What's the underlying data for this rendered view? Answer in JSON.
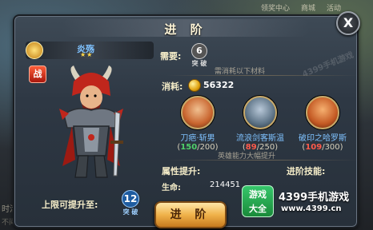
{
  "background": {
    "top_items": [
      "领奖中心",
      "商城",
      "活动"
    ],
    "left_text": "时活动",
    "left_text2": "不间断测试开始"
  },
  "dialog": {
    "title": "进  阶",
    "close_label": "X"
  },
  "hero": {
    "name": "炎殇",
    "stars": "★★",
    "class_badge": "战",
    "limit_label": "上限可提升至:",
    "limit_value": "12",
    "limit_unit": "突 破"
  },
  "requirement": {
    "label": "需要:",
    "value": "6",
    "unit": "突 破"
  },
  "materials_header": "需消耗以下材料",
  "cost": {
    "label": "消耗:",
    "value": "56322"
  },
  "materials": [
    {
      "name": "刀疤·斩男",
      "have": "150",
      "need": "/200",
      "portrait_color": "#c8642e"
    },
    {
      "name": "流浪剑客斯温",
      "have": "89",
      "need": "/250",
      "portrait_color": "#5d7386"
    },
    {
      "name": "破印之哈罗斯",
      "have": "109",
      "need": "/300",
      "portrait_color": "#c45a24"
    }
  ],
  "ability_header": "英雄能力大幅提升",
  "attributes": {
    "label": "属性提升:",
    "name": "生命:",
    "value": "214451"
  },
  "skills": {
    "label": "进阶技能:"
  },
  "advance_button": "进  阶",
  "watermark": {
    "site": "4399手机游戏",
    "logo_line1": "游戏",
    "logo_line2": "大全",
    "brand": "4399手机游戏",
    "url": "www.4399.cn"
  }
}
